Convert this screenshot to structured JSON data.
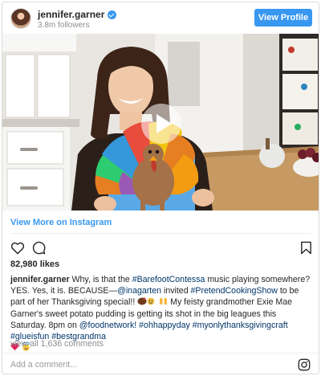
{
  "post": {
    "username": "jennifer.garner",
    "followers": "3.8m followers",
    "view_profile_label": "View Profile",
    "view_more_label": "View More on Instagram",
    "likes": "82,980 likes",
    "caption": {
      "user": "jennifer.garner",
      "p1": " Why, is that the ",
      "tag1": "#BarefootContessa",
      "p2": " music playing somewhere? YES. Yes, it is. BECAUSE—",
      "tag2": "@inagarten",
      "p3": " invited ",
      "tag3": "#PretendCookingShow",
      "p4": " to be part of her Thanksgiving special!! ",
      "p5": " My feisty grandmother Exie Mae Garner's sweet potato pudding is getting its shot in the big leagues this Saturday. 8pm on ",
      "tag4": "@foodnetwork!",
      "p6": " ",
      "tag5": "#ohhappyday",
      "p7": " ",
      "tag6": "#myonlythanksgivingcraft",
      "p8": " ",
      "tag7": "#glueisfun",
      "p9": " ",
      "tag8": "#bestgrandma"
    },
    "view_comments": "view all 1,636 comments",
    "comment_placeholder": "Add a comment...",
    "icons": [
      "heart-icon",
      "comment-icon",
      "bookmark-icon",
      "instagram-icon",
      "verified-badge-icon",
      "play-icon"
    ],
    "colors": {
      "accent": "#3897f0",
      "hashtag": "#003569",
      "muted": "#8e8e8e"
    }
  }
}
